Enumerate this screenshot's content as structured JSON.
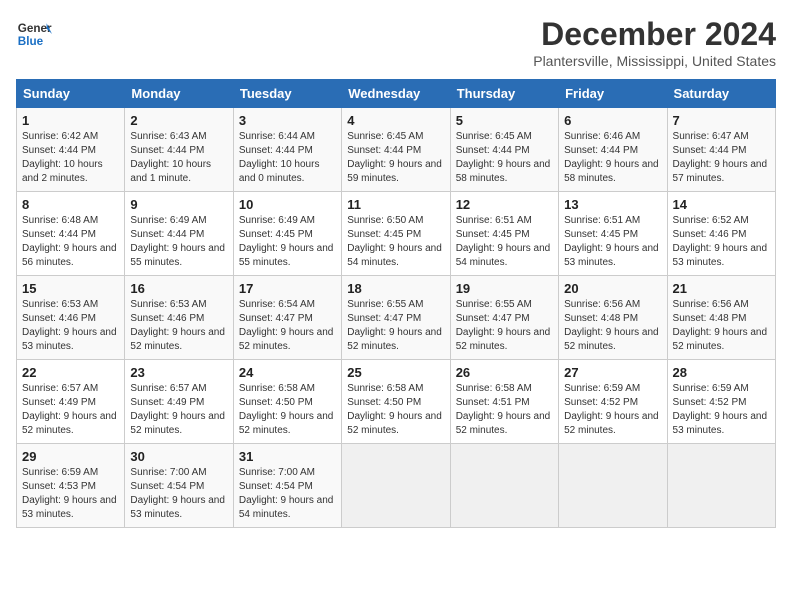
{
  "logo": {
    "line1": "General",
    "line2": "Blue"
  },
  "title": "December 2024",
  "subtitle": "Plantersville, Mississippi, United States",
  "days_header": [
    "Sunday",
    "Monday",
    "Tuesday",
    "Wednesday",
    "Thursday",
    "Friday",
    "Saturday"
  ],
  "weeks": [
    [
      {
        "day": "1",
        "sunrise": "6:42 AM",
        "sunset": "4:44 PM",
        "daylight": "10 hours and 2 minutes."
      },
      {
        "day": "2",
        "sunrise": "6:43 AM",
        "sunset": "4:44 PM",
        "daylight": "10 hours and 1 minute."
      },
      {
        "day": "3",
        "sunrise": "6:44 AM",
        "sunset": "4:44 PM",
        "daylight": "10 hours and 0 minutes."
      },
      {
        "day": "4",
        "sunrise": "6:45 AM",
        "sunset": "4:44 PM",
        "daylight": "9 hours and 59 minutes."
      },
      {
        "day": "5",
        "sunrise": "6:45 AM",
        "sunset": "4:44 PM",
        "daylight": "9 hours and 58 minutes."
      },
      {
        "day": "6",
        "sunrise": "6:46 AM",
        "sunset": "4:44 PM",
        "daylight": "9 hours and 58 minutes."
      },
      {
        "day": "7",
        "sunrise": "6:47 AM",
        "sunset": "4:44 PM",
        "daylight": "9 hours and 57 minutes."
      }
    ],
    [
      {
        "day": "8",
        "sunrise": "6:48 AM",
        "sunset": "4:44 PM",
        "daylight": "9 hours and 56 minutes."
      },
      {
        "day": "9",
        "sunrise": "6:49 AM",
        "sunset": "4:44 PM",
        "daylight": "9 hours and 55 minutes."
      },
      {
        "day": "10",
        "sunrise": "6:49 AM",
        "sunset": "4:45 PM",
        "daylight": "9 hours and 55 minutes."
      },
      {
        "day": "11",
        "sunrise": "6:50 AM",
        "sunset": "4:45 PM",
        "daylight": "9 hours and 54 minutes."
      },
      {
        "day": "12",
        "sunrise": "6:51 AM",
        "sunset": "4:45 PM",
        "daylight": "9 hours and 54 minutes."
      },
      {
        "day": "13",
        "sunrise": "6:51 AM",
        "sunset": "4:45 PM",
        "daylight": "9 hours and 53 minutes."
      },
      {
        "day": "14",
        "sunrise": "6:52 AM",
        "sunset": "4:46 PM",
        "daylight": "9 hours and 53 minutes."
      }
    ],
    [
      {
        "day": "15",
        "sunrise": "6:53 AM",
        "sunset": "4:46 PM",
        "daylight": "9 hours and 53 minutes."
      },
      {
        "day": "16",
        "sunrise": "6:53 AM",
        "sunset": "4:46 PM",
        "daylight": "9 hours and 52 minutes."
      },
      {
        "day": "17",
        "sunrise": "6:54 AM",
        "sunset": "4:47 PM",
        "daylight": "9 hours and 52 minutes."
      },
      {
        "day": "18",
        "sunrise": "6:55 AM",
        "sunset": "4:47 PM",
        "daylight": "9 hours and 52 minutes."
      },
      {
        "day": "19",
        "sunrise": "6:55 AM",
        "sunset": "4:47 PM",
        "daylight": "9 hours and 52 minutes."
      },
      {
        "day": "20",
        "sunrise": "6:56 AM",
        "sunset": "4:48 PM",
        "daylight": "9 hours and 52 minutes."
      },
      {
        "day": "21",
        "sunrise": "6:56 AM",
        "sunset": "4:48 PM",
        "daylight": "9 hours and 52 minutes."
      }
    ],
    [
      {
        "day": "22",
        "sunrise": "6:57 AM",
        "sunset": "4:49 PM",
        "daylight": "9 hours and 52 minutes."
      },
      {
        "day": "23",
        "sunrise": "6:57 AM",
        "sunset": "4:49 PM",
        "daylight": "9 hours and 52 minutes."
      },
      {
        "day": "24",
        "sunrise": "6:58 AM",
        "sunset": "4:50 PM",
        "daylight": "9 hours and 52 minutes."
      },
      {
        "day": "25",
        "sunrise": "6:58 AM",
        "sunset": "4:50 PM",
        "daylight": "9 hours and 52 minutes."
      },
      {
        "day": "26",
        "sunrise": "6:58 AM",
        "sunset": "4:51 PM",
        "daylight": "9 hours and 52 minutes."
      },
      {
        "day": "27",
        "sunrise": "6:59 AM",
        "sunset": "4:52 PM",
        "daylight": "9 hours and 52 minutes."
      },
      {
        "day": "28",
        "sunrise": "6:59 AM",
        "sunset": "4:52 PM",
        "daylight": "9 hours and 53 minutes."
      }
    ],
    [
      {
        "day": "29",
        "sunrise": "6:59 AM",
        "sunset": "4:53 PM",
        "daylight": "9 hours and 53 minutes."
      },
      {
        "day": "30",
        "sunrise": "7:00 AM",
        "sunset": "4:54 PM",
        "daylight": "9 hours and 53 minutes."
      },
      {
        "day": "31",
        "sunrise": "7:00 AM",
        "sunset": "4:54 PM",
        "daylight": "9 hours and 54 minutes."
      },
      null,
      null,
      null,
      null
    ]
  ]
}
